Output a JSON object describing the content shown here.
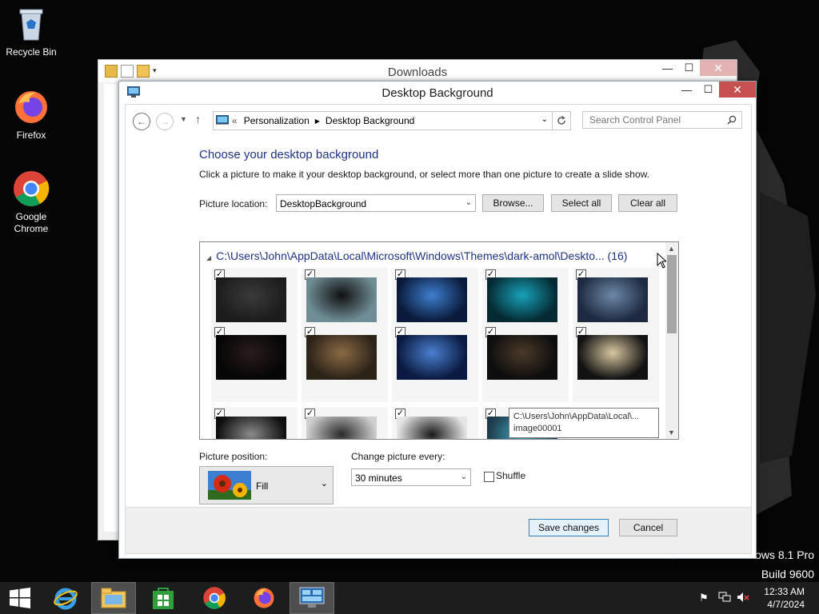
{
  "desktop": {
    "icons": [
      {
        "label": "Recycle Bin"
      },
      {
        "label": "Firefox"
      },
      {
        "label": "Google Chrome"
      }
    ],
    "watermark_line1": "ows 8.1 Pro",
    "watermark_line2": "Build 9600"
  },
  "downloads_window": {
    "title": "Downloads"
  },
  "window": {
    "title": "Desktop Background",
    "breadcrumb": [
      "Personalization",
      "Desktop Background"
    ],
    "breadcrumb_prefix": "«",
    "search_placeholder": "Search Control Panel"
  },
  "content": {
    "heading": "Choose your desktop background",
    "description": "Click a picture to make it your desktop background, or select more than one picture to create a slide show.",
    "picture_location_label": "Picture location:",
    "picture_location_value": "DesktopBackground",
    "browse_label": "Browse...",
    "select_all_label": "Select all",
    "clear_all_label": "Clear all",
    "group_header": "C:\\Users\\John\\AppData\\Local\\Microsoft\\Windows\\Themes\\dark-amol\\Deskto... (16)",
    "thumbnails_checked": [
      true,
      true,
      true,
      true,
      true,
      true,
      true,
      true,
      true,
      true,
      true,
      true,
      true,
      true
    ],
    "tooltip_line1": "C:\\Users\\John\\AppData\\Local\\...",
    "tooltip_line2": "image00001",
    "picture_position_label": "Picture position:",
    "picture_position_value": "Fill",
    "change_every_label": "Change picture every:",
    "change_every_value": "30 minutes",
    "shuffle_label": "Shuffle",
    "shuffle_checked": false
  },
  "footer": {
    "save_label": "Save changes",
    "cancel_label": "Cancel"
  },
  "taskbar": {
    "time": "12:33 AM",
    "date": "4/7/2024",
    "items": [
      "start-icon",
      "internet-explorer-icon",
      "file-explorer-icon",
      "store-icon",
      "chrome-icon",
      "firefox-icon",
      "control-panel-icon"
    ]
  }
}
